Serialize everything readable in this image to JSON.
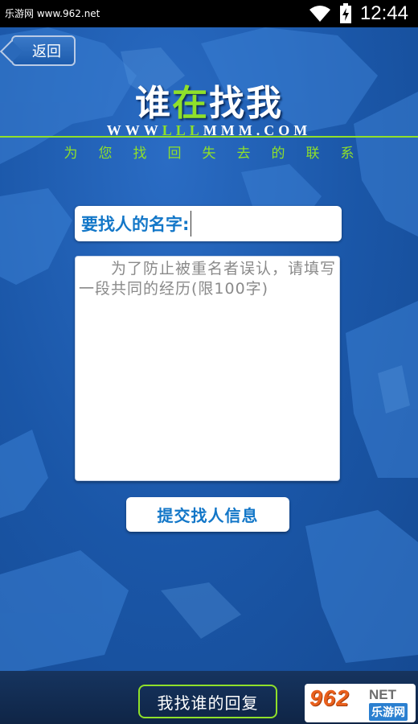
{
  "status_bar": {
    "watermark_text": "乐游网 www.962.net",
    "time": "12:44",
    "icons": [
      "wifi-icon",
      "battery-icon"
    ]
  },
  "header": {
    "back_label": "返回",
    "logo_white_1": "谁",
    "logo_green": "在",
    "logo_white_2": "找我",
    "url_white_1": "WWW",
    "url_green": "LLL",
    "url_white_2": "MMM.COM",
    "slogan": "为您找回失去的联系"
  },
  "form": {
    "name_label": "要找人的名字:",
    "name_value": "",
    "experience_placeholder": "为了防止被重名者误认，请填写一段共同的经历(限100字)",
    "submit_label": "提交找人信息"
  },
  "bottom_bar": {
    "reply_label": "我找谁的回复",
    "watermark_number": "962",
    "watermark_suffix": "NET",
    "watermark_cn": "乐游网"
  },
  "colors": {
    "accent_green": "#8fe02a",
    "label_blue": "#1377c8",
    "background_blue": "#1a56a7"
  }
}
